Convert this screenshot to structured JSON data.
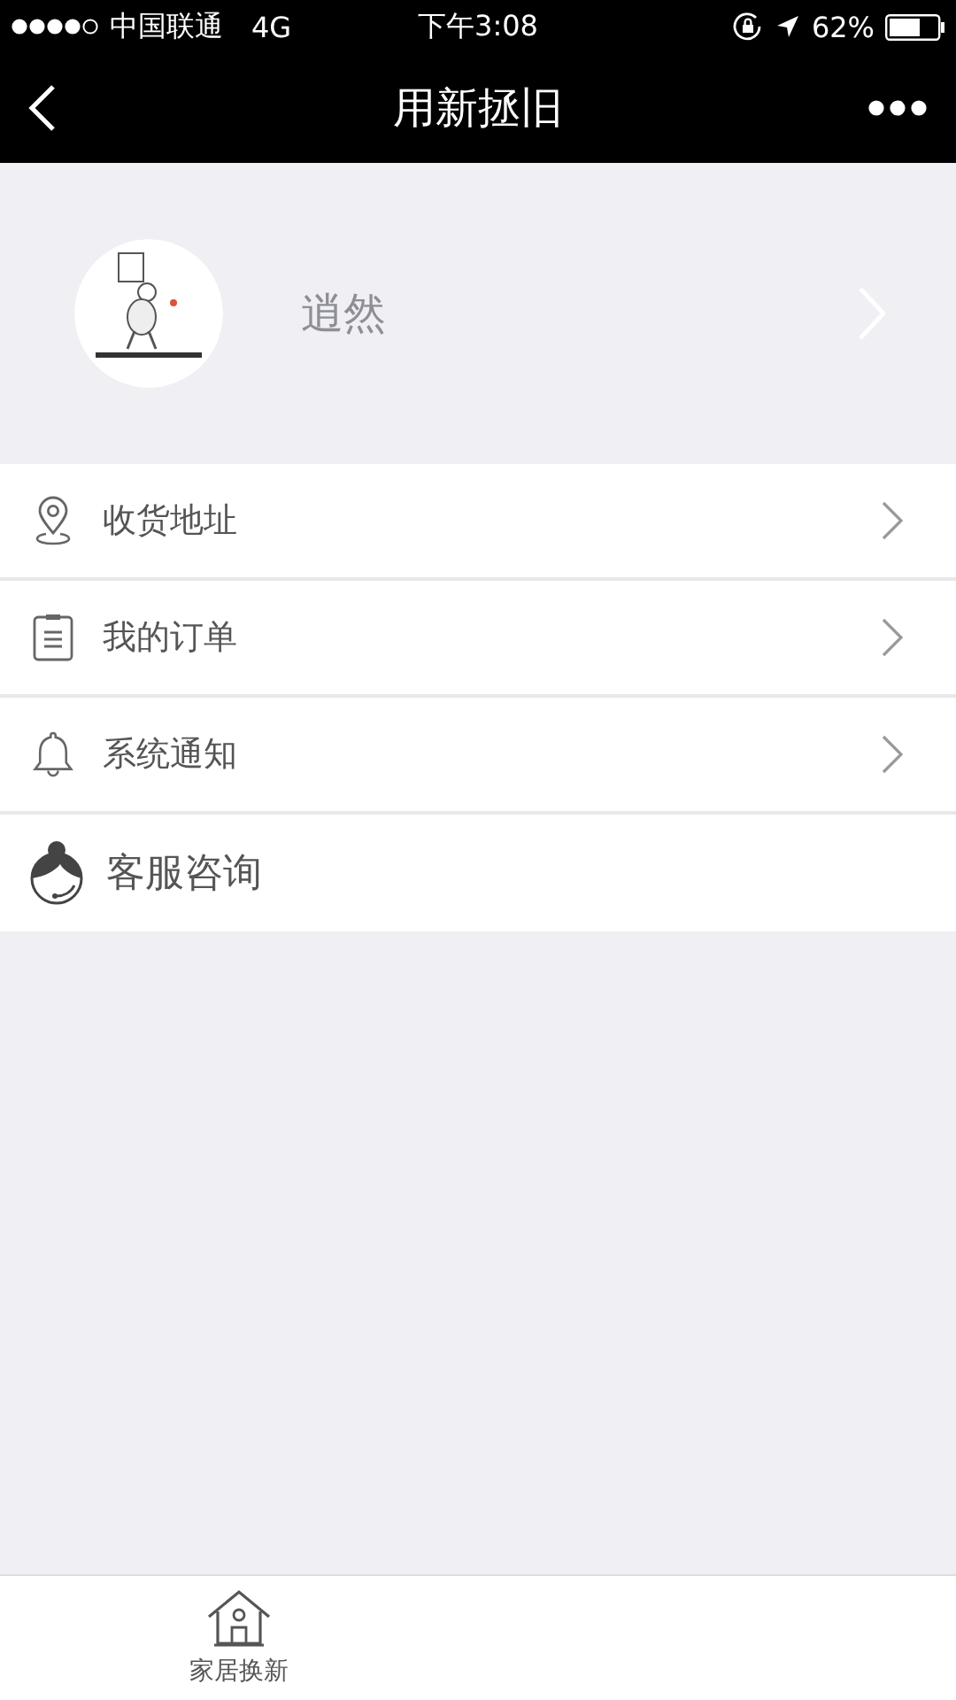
{
  "status_bar": {
    "carrier": "中国联通",
    "network": "4G",
    "time": "下午3:08",
    "battery": "62%"
  },
  "nav": {
    "title": "用新拯旧"
  },
  "profile": {
    "name": "逍然"
  },
  "menu": [
    {
      "kind": "pin",
      "label": "收货地址",
      "chevron": true
    },
    {
      "kind": "clipboard",
      "label": "我的订单",
      "chevron": true
    },
    {
      "kind": "bell",
      "label": "系统通知",
      "chevron": true
    },
    {
      "kind": "agent",
      "label": "客服咨询",
      "chevron": false
    }
  ],
  "tab_bar": [
    {
      "kind": "home",
      "label": "家居换新"
    }
  ]
}
